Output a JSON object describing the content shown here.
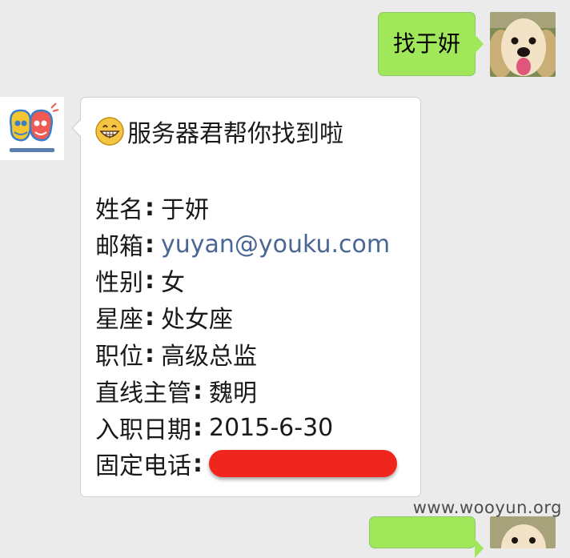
{
  "messages": [
    {
      "from": "me",
      "text": "找于妍"
    },
    {
      "from": "bot",
      "header": "服务器君帮你找到啦",
      "header_icon": "grinning-face-icon",
      "fields": [
        {
          "label": "姓名",
          "value": "于妍"
        },
        {
          "label": "邮箱",
          "value": "yuyan@youku.com"
        },
        {
          "label": "性别",
          "value": "女"
        },
        {
          "label": "星座",
          "value": "处女座"
        },
        {
          "label": "职位",
          "value": "高级总监"
        },
        {
          "label": "直线主管",
          "value": "魏明"
        },
        {
          "label": "入职日期",
          "value": "2015-6-30"
        },
        {
          "label": "固定电话",
          "value": ""
        }
      ],
      "colon": ":"
    }
  ],
  "watermark": "www.wooyun.org",
  "colors": {
    "background": "#ebebeb",
    "my_bubble": "#a0e759",
    "link": "#4a6694",
    "redaction": "#f0261e"
  }
}
